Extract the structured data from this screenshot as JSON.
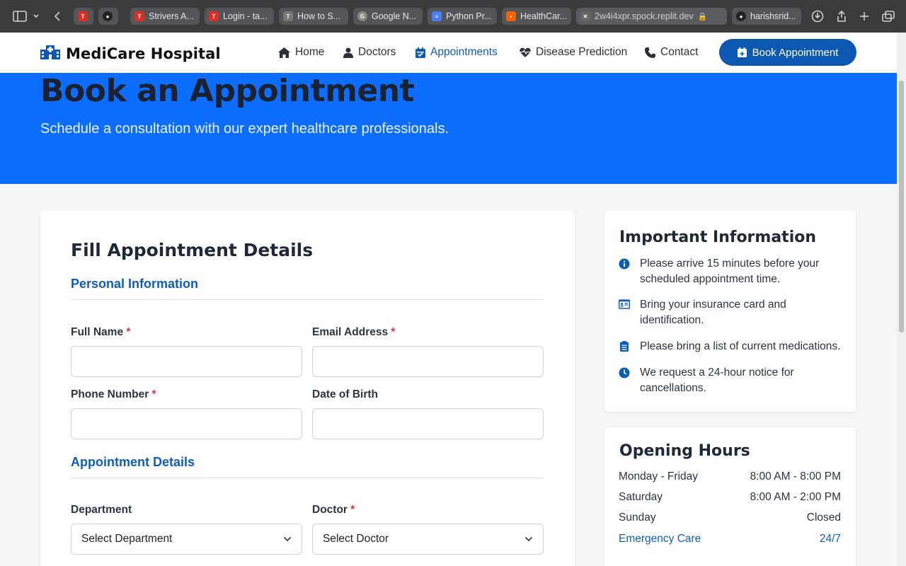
{
  "browser": {
    "tabs": [
      {
        "label": "",
        "icon": "tuf-icon",
        "color": "#d93025"
      },
      {
        "label": "",
        "icon": "github-icon",
        "color": "#222222"
      },
      {
        "label": "Strivers A...",
        "icon": "tuf-icon",
        "color": "#d93025"
      },
      {
        "label": "Login - ta...",
        "icon": "tuf-icon",
        "color": "#d93025"
      },
      {
        "label": "How to S...",
        "icon": "t-icon",
        "color": "#777777"
      },
      {
        "label": "Google N...",
        "icon": "google-icon",
        "color": "#888888"
      },
      {
        "label": "Python Pr...",
        "icon": "docs-icon",
        "color": "#4a7ef6"
      },
      {
        "label": "HealthCar...",
        "icon": "replit-icon",
        "color": "#f26207"
      },
      {
        "label": "2w4i4xpr.spock.replit.dev",
        "icon": "close-icon",
        "color": "#555555"
      },
      {
        "label": "harishsrid...",
        "icon": "github-icon",
        "color": "#222222"
      }
    ]
  },
  "nav": {
    "brand": "MediCare Hospital",
    "links": [
      {
        "label": "Home",
        "icon": "home-icon"
      },
      {
        "label": "Doctors",
        "icon": "doctor-icon"
      },
      {
        "label": "Appointments",
        "icon": "calendar-icon"
      },
      {
        "label": "Disease Prediction",
        "icon": "heart-pulse-icon"
      },
      {
        "label": "Contact",
        "icon": "phone-icon"
      }
    ],
    "cta": "Book Appointment"
  },
  "hero": {
    "title": "Book an Appointment",
    "subtitle": "Schedule a consultation with our expert healthcare professionals."
  },
  "form": {
    "title": "Fill Appointment Details",
    "personal_section": "Personal Information",
    "full_name_label": "Full Name",
    "email_label": "Email Address",
    "phone_label": "Phone Number",
    "dob_label": "Date of Birth",
    "appointment_section": "Appointment Details",
    "department_label": "Department",
    "department_value": "Select Department",
    "doctor_label": "Doctor",
    "doctor_value": "Select Doctor",
    "required_mark": "*"
  },
  "info": {
    "title": "Important Information",
    "items": [
      {
        "text": "Please arrive 15 minutes before your scheduled appointment time.",
        "icon": "info-icon"
      },
      {
        "text": "Bring your insurance card and identification.",
        "icon": "id-card-icon"
      },
      {
        "text": "Please bring a list of current medications.",
        "icon": "clipboard-icon"
      },
      {
        "text": "We request a 24-hour notice for cancellations.",
        "icon": "clock-icon"
      }
    ]
  },
  "hours": {
    "title": "Opening Hours",
    "rows": [
      {
        "day": "Monday - Friday",
        "time": "8:00 AM - 8:00 PM"
      },
      {
        "day": "Saturday",
        "time": "8:00 AM - 2:00 PM"
      },
      {
        "day": "Sunday",
        "time": "Closed"
      },
      {
        "day": "Emergency Care",
        "time": "24/7"
      }
    ]
  },
  "colors": {
    "primary": "#0d6efd",
    "brand_blue": "#0c58b3",
    "required": "#dc3545"
  }
}
